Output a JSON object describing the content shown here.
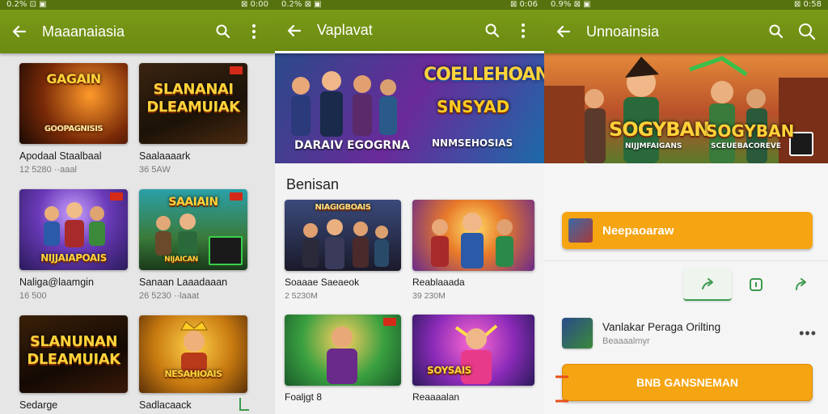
{
  "colors": {
    "appbar": "#6b8a12",
    "accent_orange": "#f5a412",
    "status_red": "#d52a18",
    "icon_green": "#3c9a4e"
  },
  "screens": [
    {
      "status": {
        "left": "0.2% ⊡ ▣",
        "right": "⊠ 0:00"
      },
      "title": "Maaanaiasia",
      "actions": [
        "search-icon",
        "more-vert-icon"
      ],
      "cards": [
        {
          "title": "Apodaal Staalbaal",
          "sub": "12 5280 ··aaal",
          "art": "GAGAIN",
          "art2": "GOOPAGNISIS"
        },
        {
          "title": "Saalaaaark",
          "sub": "36 5AW",
          "art": "SLANANAI DLEAMUIAK",
          "art2": ""
        },
        {
          "title": "Naliga@laamgin",
          "sub": "16 500",
          "art": "NIJJAIAPOAIS",
          "art2": ""
        },
        {
          "title": "Sanaan Laaadaaan",
          "sub": "26 5230 ··laaat",
          "art": "SAAIAIN",
          "art2": "NIJAICAN"
        },
        {
          "title": "Sedarge",
          "sub": "",
          "art": "SLANUNAN DLEAMUIAK",
          "art2": ""
        },
        {
          "title": "Sadlacaack",
          "sub": "",
          "art": "NESAHIOAIS",
          "art2": ""
        }
      ]
    },
    {
      "status": {
        "left": "0.2% ⊠ ▣",
        "right": "⊠ 0:06"
      },
      "title": "Vaplavat",
      "actions": [
        "search-icon",
        "more-vert-icon"
      ],
      "hero": {
        "left_caption": "DARAIV EGOGRNA",
        "right_caption": "COELLEHOAN",
        "right_caption2": "SNSYAD",
        "right_caption3": "NNMSEHOSIAS"
      },
      "section_title": "Benisan",
      "cards": [
        {
          "title": "Soaaae Saeaeok",
          "sub": "2 5230M",
          "art": "NIAGIGBOAIS"
        },
        {
          "title": "Reablaaada",
          "sub": "39 230M",
          "art": ""
        },
        {
          "title": "Foaljgt 8",
          "sub": "",
          "art": ""
        },
        {
          "title": "Reaaaalan",
          "sub": "",
          "art": "SOYSAIS"
        }
      ]
    },
    {
      "status": {
        "left": "0.9% ⊠ ▣",
        "right": "⊠ 0:58"
      },
      "title": "Unnoainsia",
      "actions": [
        "search-icon",
        "search-icon"
      ],
      "hero": {
        "caption": "SOGYBAN",
        "caption_sub": "NIJJMFAIGANS",
        "caption2": "SOGYBAN",
        "caption2_sub": "SCEUEBACOREVE"
      },
      "primary_button": "Neepaoaraw",
      "icon_buttons": [
        "share-icon",
        "badge-icon",
        "reply-icon"
      ],
      "item": {
        "title": "Vanlakar Peraga Orilting",
        "sub": "Beaaaalmyr",
        "more": "•••"
      },
      "bottom_button": "BNB GANSNEMAN"
    }
  ]
}
